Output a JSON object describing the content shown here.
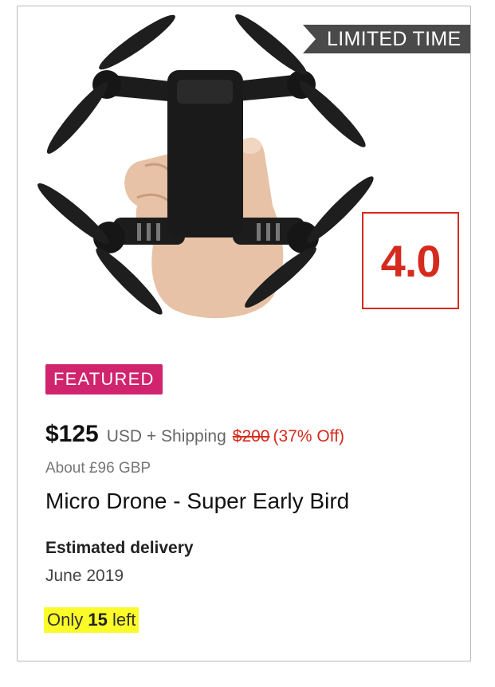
{
  "card": {
    "image_alt": "Black foldable micro drone held in a hand",
    "ribbon_label": "LIMITED TIME",
    "rating": "4.0",
    "badge": "FEATURED",
    "price": "$125",
    "price_suffix": "USD + Shipping",
    "original_price": "$200",
    "discount": "(37% Off)",
    "converted_price": "About £96 GBP",
    "title": "Micro Drone - Super Early Bird",
    "delivery_label": "Estimated delivery",
    "delivery_date": "June 2019",
    "stock_prefix": "Only",
    "stock_count": "15",
    "stock_suffix": "left"
  },
  "colors": {
    "accent_red": "#d52b1e",
    "badge_pink": "#d0246e",
    "ribbon_dark": "#4a4a4a",
    "highlight_yellow": "#fbfb2a"
  }
}
